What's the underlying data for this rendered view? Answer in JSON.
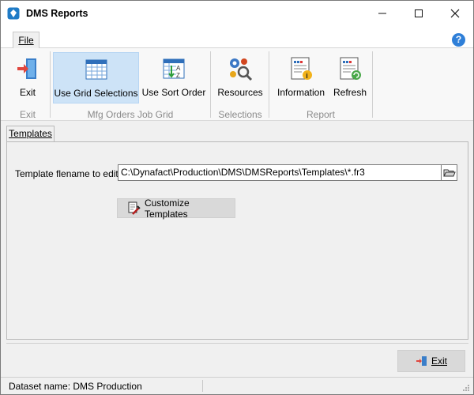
{
  "window": {
    "title": "DMS Reports",
    "minimize_glyph": "—",
    "maximize_glyph": "☐",
    "close_glyph": "✕"
  },
  "ribbon": {
    "file_tab": "File",
    "help_glyph": "?",
    "buttons": {
      "exit": "Exit",
      "use_grid_selections": "Use Grid Selections",
      "use_sort_order": "Use Sort Order",
      "resources": "Resources",
      "information": "Information",
      "refresh": "Refresh"
    },
    "groups": {
      "exit": "Exit",
      "mfg_orders_job_grid": "Mfg Orders Job Grid",
      "selections": "Selections",
      "report": "Report"
    }
  },
  "content": {
    "tab_label": "Templates",
    "template_label": "Template flename to edit:",
    "template_path": "C:\\Dynafact\\Production\\DMS\\DMSReports\\Templates\\*.fr3",
    "customize_button": "Customize Templates"
  },
  "footer": {
    "exit_button": "Exit"
  },
  "status": {
    "dataset": "Dataset name:  DMS Production"
  }
}
